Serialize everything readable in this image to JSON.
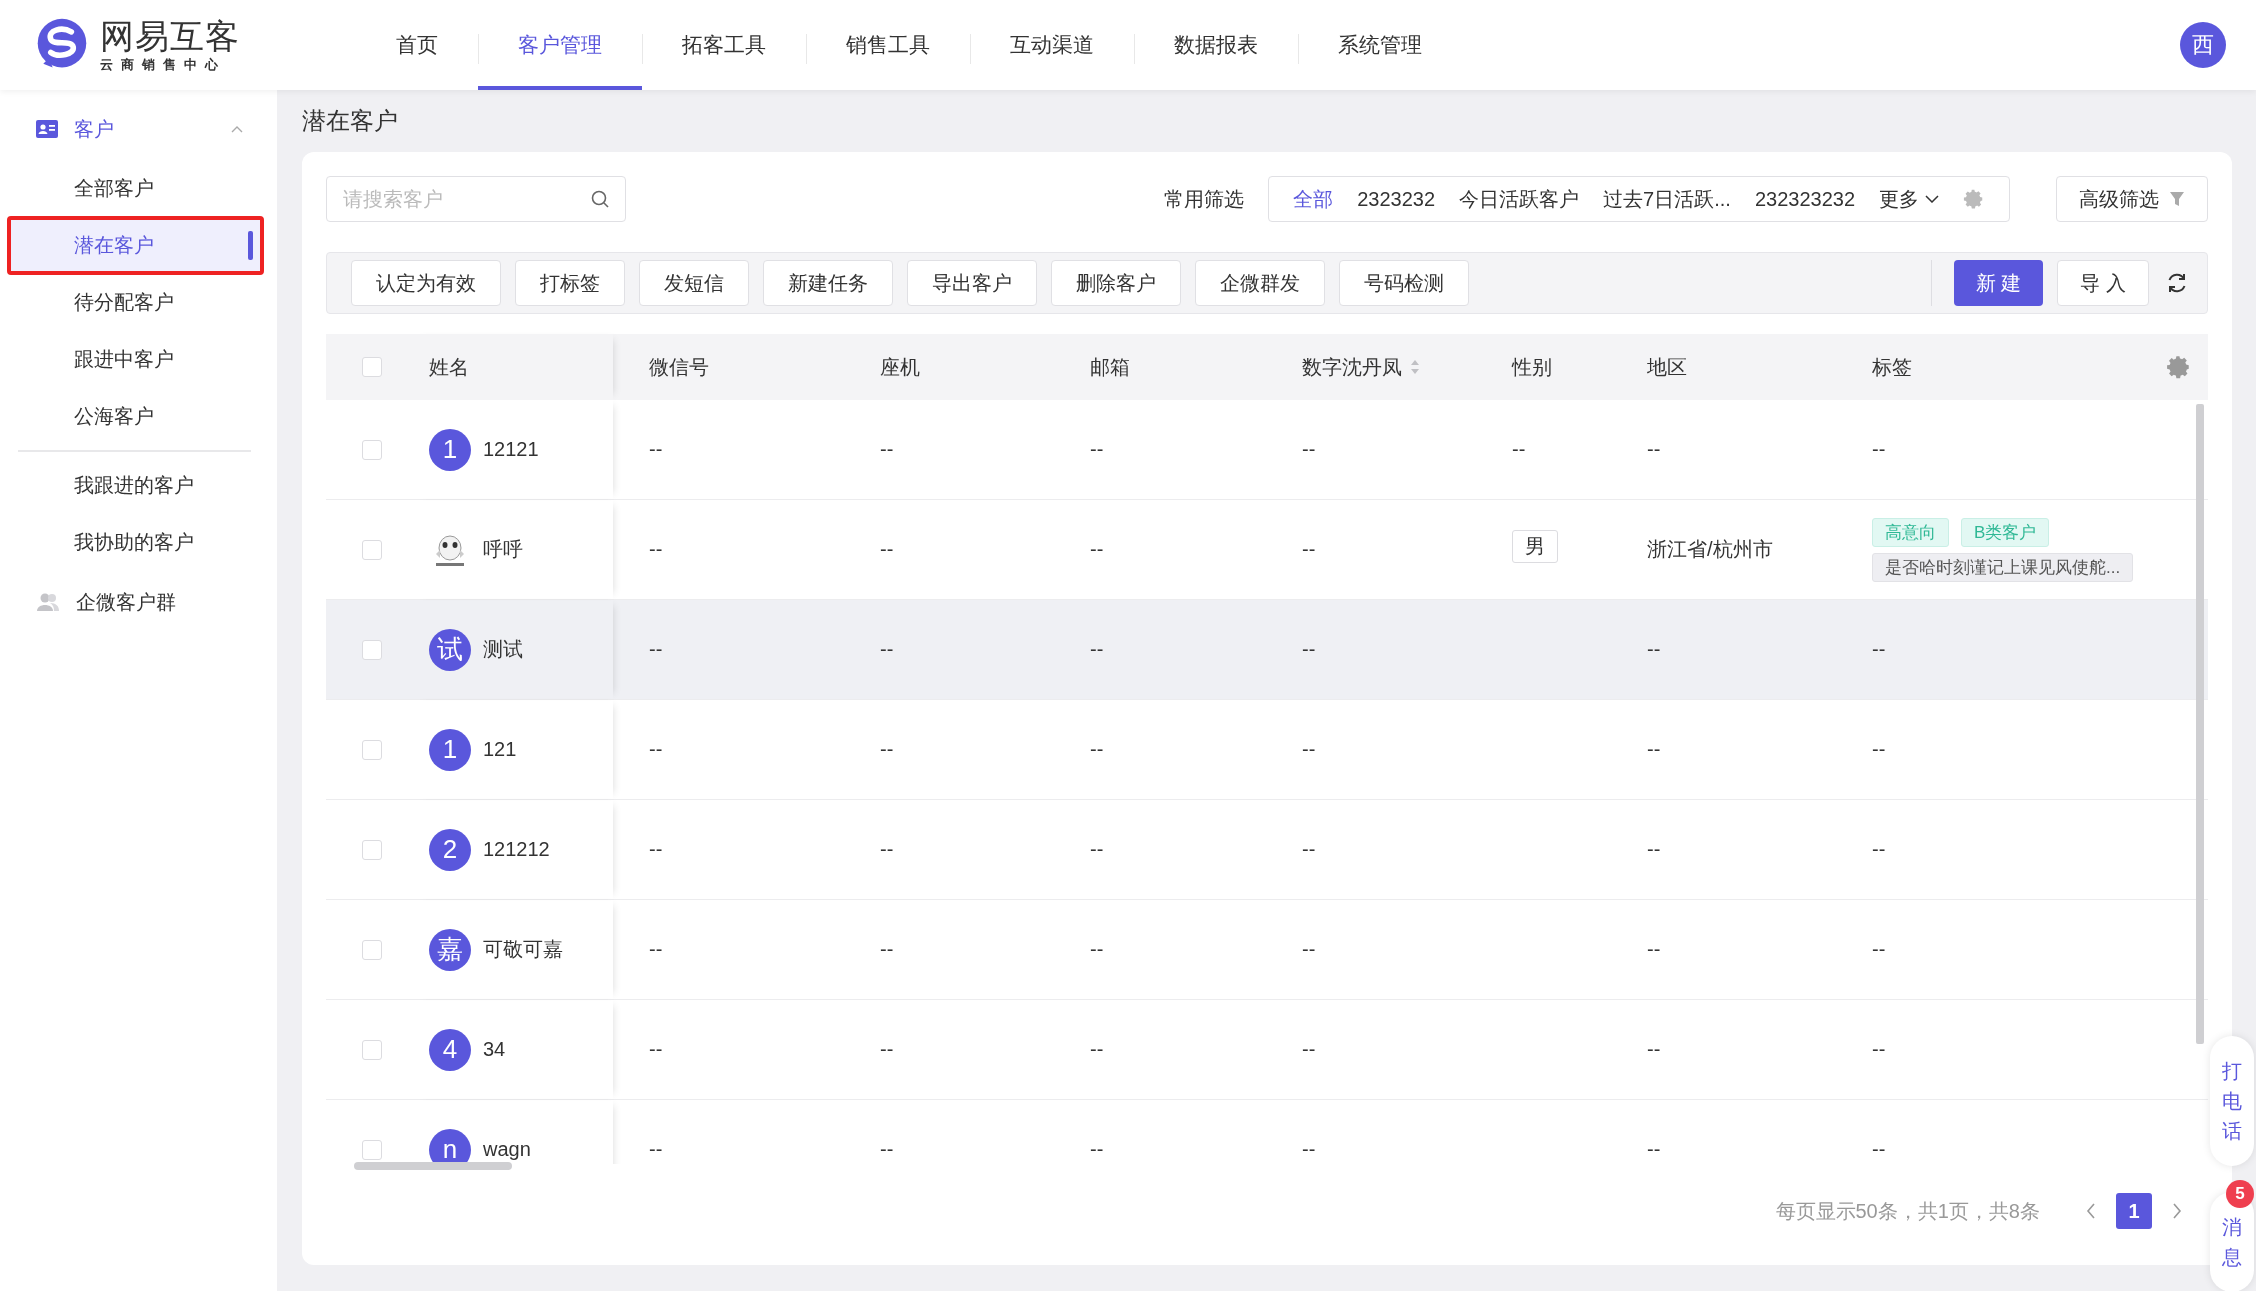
{
  "logo": {
    "name": "网易互客",
    "subtitle": "云商销售中心"
  },
  "nav": [
    {
      "label": "首页",
      "selected": false
    },
    {
      "label": "客户管理",
      "selected": true
    },
    {
      "label": "拓客工具",
      "selected": false
    },
    {
      "label": "销售工具",
      "selected": false
    },
    {
      "label": "互动渠道",
      "selected": false
    },
    {
      "label": "数据报表",
      "selected": false
    },
    {
      "label": "系统管理",
      "selected": false
    }
  ],
  "user_avatar": "西",
  "sidebar": {
    "groups": [
      {
        "label": "客户",
        "kind": "card",
        "expanded": true,
        "selected": true,
        "items": [
          {
            "label": "全部客户",
            "selected": false,
            "highlighted": false
          },
          {
            "label": "潜在客户",
            "selected": true,
            "highlighted": true
          },
          {
            "label": "待分配客户",
            "selected": false,
            "highlighted": false
          },
          {
            "label": "跟进中客户",
            "selected": false,
            "highlighted": false
          },
          {
            "label": "公海客户",
            "selected": false,
            "highlighted": false
          },
          {
            "label": "我跟进的客户",
            "selected": false,
            "highlighted": false,
            "divider_before": true
          },
          {
            "label": "我协助的客户",
            "selected": false,
            "highlighted": false
          }
        ]
      },
      {
        "label": "企微客户群",
        "kind": "people",
        "selected": false
      }
    ]
  },
  "page_title": "潜在客户",
  "search": {
    "placeholder": "请搜索客户"
  },
  "quick_filter": {
    "label": "常用筛选",
    "options": [
      {
        "label": "全部",
        "selected": true
      },
      {
        "label": "2323232",
        "selected": false
      },
      {
        "label": "今日活跃客户",
        "selected": false
      },
      {
        "label": "过去7日活跃...",
        "selected": false
      },
      {
        "label": "232323232",
        "selected": false
      }
    ],
    "more": "更多"
  },
  "advanced_filter": "高级筛选",
  "actions": [
    "认定为有效",
    "打标签",
    "发短信",
    "新建任务",
    "导出客户",
    "删除客户",
    "企微群发",
    "号码检测"
  ],
  "primary_button": "新 建",
  "import_button": "导 入",
  "table": {
    "all_checked": false,
    "columns": [
      {
        "label": "姓名"
      },
      {
        "label": "微信号"
      },
      {
        "label": "座机"
      },
      {
        "label": "邮箱"
      },
      {
        "label": "数字沈丹凤",
        "sortable": true
      },
      {
        "label": "性别"
      },
      {
        "label": "地区"
      },
      {
        "label": "标签"
      }
    ],
    "rows": [
      {
        "checked": false,
        "cells": [
          {
            "kind": "person",
            "avatar": {
              "kind": "letter",
              "text": "1"
            },
            "name": "12121"
          },
          "--",
          "--",
          "--",
          "--",
          "--",
          "--",
          "--"
        ]
      },
      {
        "checked": false,
        "cells": [
          {
            "kind": "person",
            "name": "呼呼"
          },
          "--",
          "--",
          "--",
          "--",
          {
            "kind": "boxed",
            "text": "男"
          },
          "浙江省/杭州市",
          {
            "kind": "tags",
            "tags": [
              {
                "label": "高意向",
                "kind": "label"
              },
              {
                "label": "B类客户",
                "kind": "label"
              },
              {
                "label": "是否哈时刻谨记上课见风使舵...",
                "kind": "remark"
              }
            ]
          }
        ]
      },
      {
        "checked": false,
        "hovered": true,
        "cells": [
          {
            "kind": "person",
            "avatar": {
              "kind": "letter",
              "text": "试"
            },
            "name": "测试"
          },
          "--",
          "--",
          "--",
          "--",
          "",
          "--",
          "--"
        ]
      },
      {
        "checked": false,
        "cells": [
          {
            "kind": "person",
            "avatar": {
              "kind": "letter",
              "text": "1"
            },
            "name": "121"
          },
          "--",
          "--",
          "--",
          "--",
          "",
          "--",
          "--"
        ]
      },
      {
        "checked": false,
        "cells": [
          {
            "kind": "person",
            "avatar": {
              "kind": "letter",
              "text": "2"
            },
            "name": "121212"
          },
          "--",
          "--",
          "--",
          "--",
          "",
          "--",
          "--"
        ]
      },
      {
        "checked": false,
        "cells": [
          {
            "kind": "person",
            "avatar": {
              "kind": "letter",
              "text": "嘉"
            },
            "name": "可敬可嘉"
          },
          "--",
          "--",
          "--",
          "--",
          "",
          "--",
          "--"
        ]
      },
      {
        "checked": false,
        "cells": [
          {
            "kind": "person",
            "avatar": {
              "kind": "letter",
              "text": "4"
            },
            "name": "34"
          },
          "--",
          "--",
          "--",
          "--",
          "",
          "--",
          "--"
        ]
      },
      {
        "checked": false,
        "cells": [
          {
            "kind": "person",
            "avatar": {
              "kind": "letter",
              "text": "n"
            },
            "name": "wagn"
          },
          "--",
          "--",
          "--",
          "--",
          "",
          "--",
          "--"
        ]
      }
    ]
  },
  "pagination": {
    "summary": "每页显示50条，共1页，共8条",
    "pages": [
      {
        "label": "1",
        "selected": true
      }
    ]
  },
  "float_buttons": [
    {
      "label": "打电话"
    },
    {
      "label": "消息",
      "badge": "5"
    }
  ]
}
